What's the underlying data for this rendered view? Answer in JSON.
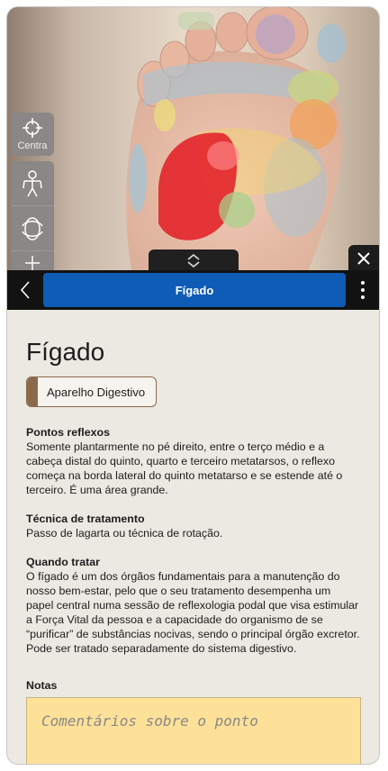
{
  "toolbar": {
    "center_label": "Centra",
    "center_icon": "crosshair-icon",
    "body_icon": "human-body-icon",
    "rotate_icon": "rotate-3d-icon"
  },
  "header": {
    "title": "Fígado",
    "back_icon": "chevron-left-icon",
    "menu_icon": "more-vertical-icon",
    "close_icon": "close-icon",
    "handle_icon": "chevron-up-down-icon"
  },
  "detail": {
    "heading": "Fígado",
    "category": "Aparelho Digestivo",
    "sections": [
      {
        "title": "Pontos reflexos",
        "text": "Somente plantarmente no pé direito, entre o terço médio e a cabeça distal do quinto, quarto e terceiro metatarsos, o reflexo começa na borda lateral do quinto metatarso e se estende até o terceiro. É uma área grande."
      },
      {
        "title": "Técnica de tratamento",
        "text": "Passo de lagarta ou técnica de rotação."
      },
      {
        "title": "Quando tratar",
        "text": "O fígado é um dos órgãos fundamentais para a manutenção do nosso bem-estar, pelo que o seu tratamento desempenha um papel central numa sessão de reflexologia podal que visa estimular a Força Vital da pessoa e a capacidade do organismo de se “purificar” de substâncias nocivas, sendo o principal órgão excretor. Pode ser tratado separadamente do sistema digestivo."
      }
    ],
    "notes_label": "Notas",
    "notes_placeholder": "Comentários sobre o ponto"
  },
  "colors": {
    "accent": "#0e5cb5",
    "tag": "#8b6a4b",
    "notes_bg": "#fde199"
  }
}
